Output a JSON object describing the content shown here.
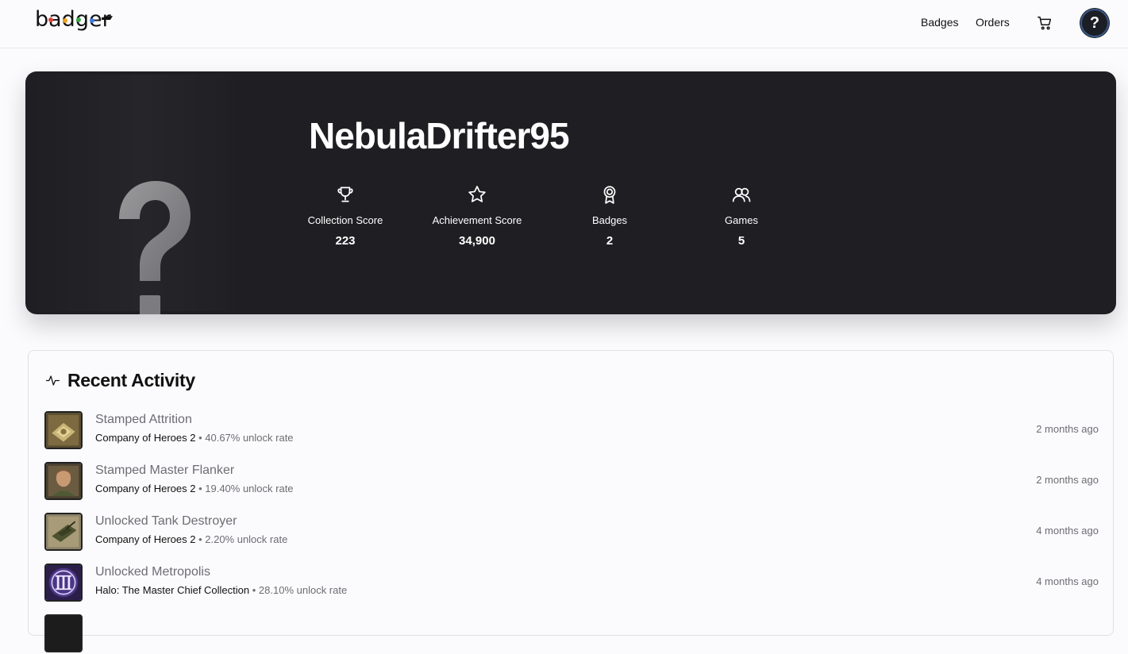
{
  "nav": {
    "logo_text": "badger",
    "links": [
      "Badges",
      "Orders"
    ],
    "help_label": "?"
  },
  "profile": {
    "username": "NebulaDrifter95",
    "avatar_placeholder": "?",
    "stats": [
      {
        "icon": "trophy-icon",
        "label": "Collection Score",
        "value": "223"
      },
      {
        "icon": "star-icon",
        "label": "Achievement Score",
        "value": "34,900"
      },
      {
        "icon": "award-icon",
        "label": "Badges",
        "value": "2"
      },
      {
        "icon": "users-icon",
        "label": "Games",
        "value": "5"
      }
    ]
  },
  "activity": {
    "title": "Recent Activity",
    "items": [
      {
        "title": "Stamped Attrition",
        "game": "Company of Heroes 2",
        "detail": "• 40.67% unlock rate",
        "time": "2 months ago"
      },
      {
        "title": "Stamped Master Flanker",
        "game": "Company of Heroes 2",
        "detail": "• 19.40% unlock rate",
        "time": "2 months ago"
      },
      {
        "title": "Unlocked Tank Destroyer",
        "game": "Company of Heroes 2",
        "detail": "• 2.20% unlock rate",
        "time": "4 months ago"
      },
      {
        "title": "Unlocked Metropolis",
        "game": "Halo: The Master Chief Collection",
        "detail": "• 28.10% unlock rate",
        "time": "4 months ago"
      }
    ]
  },
  "colors": {
    "hero_bg": "#1f1f23",
    "page_bg": "#fbfbfd",
    "muted_text": "#6d6d73"
  }
}
